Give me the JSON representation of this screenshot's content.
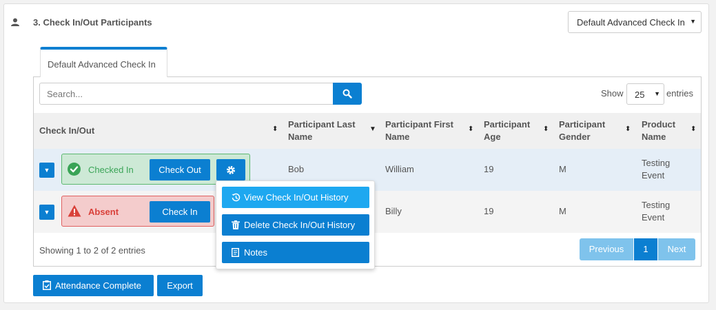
{
  "section": {
    "title": "3. Check In/Out Participants",
    "mode_selected": "Default Advanced Check In"
  },
  "tab": {
    "label": "Default Advanced Check In"
  },
  "search": {
    "placeholder": "Search..."
  },
  "show": {
    "label": "Show",
    "value": "25",
    "suffix": "entries"
  },
  "columns": {
    "check": "Check In/Out",
    "last_a": "Participant Last",
    "last_b": "Name",
    "first_a": "Participant First",
    "first_b": "Name",
    "age_a": "Participant",
    "age_b": "Age",
    "gender_a": "Participant",
    "gender_b": "Gender",
    "product_a": "Product",
    "product_b": "Name"
  },
  "rows": [
    {
      "status": "Checked In",
      "action": "Check Out",
      "last": "Bob",
      "first": "William",
      "age": "19",
      "gender": "M",
      "product_a": "Testing",
      "product_b": "Event"
    },
    {
      "status": "Absent",
      "action": "Check In",
      "last": "",
      "first": "Billy",
      "age": "19",
      "gender": "M",
      "product_a": "Testing",
      "product_b": "Event"
    }
  ],
  "footer": {
    "info": "Showing 1 to 2 of 2 entries"
  },
  "pagination": {
    "prev": "Previous",
    "current": "1",
    "next": "Next"
  },
  "menu": {
    "view": "View Check In/Out History",
    "delete": "Delete Check In/Out History",
    "notes": "Notes"
  },
  "actions": {
    "attendance": "Attendance Complete",
    "export": "Export"
  },
  "colors": {
    "primary": "#0b7fd1",
    "success": "#5cb86f",
    "danger": "#d9413a"
  }
}
